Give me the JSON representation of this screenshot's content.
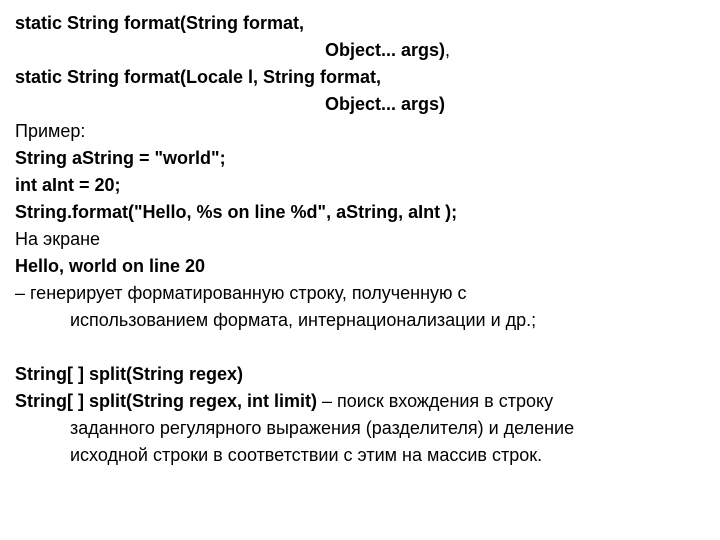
{
  "l1": "static String format(String format,",
  "l2": "Object... args)",
  "l2_after": ",",
  "l3": "static String format(Locale l, String format,",
  "l4": "Object... args)",
  "l5": "Пример:",
  "l6": "String aString = \"world\";",
  "l7": "int aInt = 20;",
  "l8": "String.format(\"Hello, %s on line %d\", aString, aInt );",
  "l9": "На экране",
  "l10": "Hello, world on line 20",
  "l11a": "– генерирует форматированную строку, полученную с",
  "l11b": "использованием формата, интернационализации и др.;",
  "l12": "String[ ] split(String regex)",
  "l13a": "String[ ] split(String regex, int limit)",
  "l13b": " – поиск вхождения в строку",
  "l13c": "заданного регулярного выражения (разделителя) и деление",
  "l13d": "исходной строки в соответствии с этим на массив строк."
}
